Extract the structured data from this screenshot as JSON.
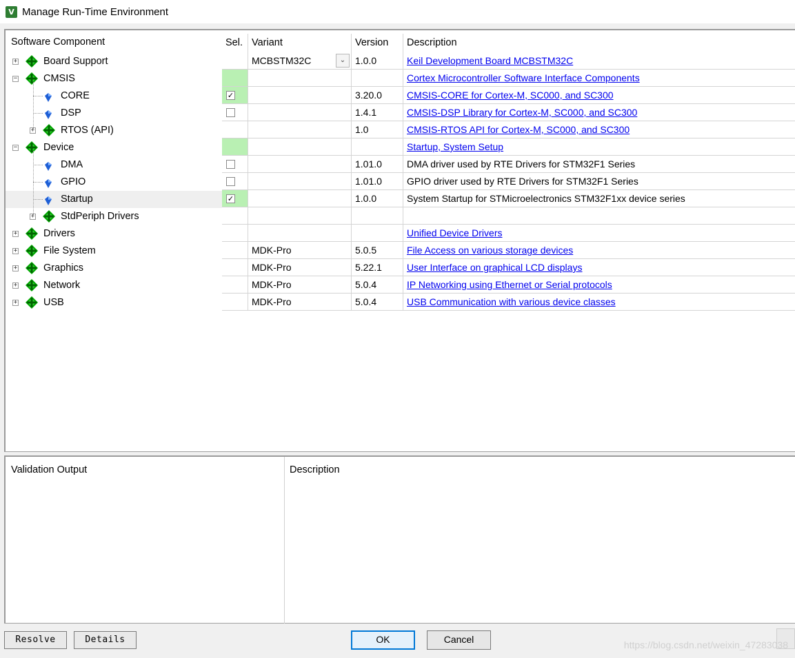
{
  "window": {
    "title": "Manage Run-Time Environment",
    "icon": "keil-app-icon"
  },
  "columns": {
    "component": "Software Component",
    "sel": "Sel.",
    "variant": "Variant",
    "version": "Version",
    "description": "Description"
  },
  "rows": [
    {
      "label": "Board Support",
      "level": 0,
      "expander": "+",
      "icon": "green-diamond-icon",
      "sel": "",
      "sel_green": false,
      "variant": "MCBSTM32C",
      "dropdown": true,
      "version": "1.0.0",
      "desc": "Keil Development Board MCBSTM32C",
      "link": true
    },
    {
      "label": "CMSIS",
      "level": 0,
      "expander": "−",
      "icon": "green-diamond-icon",
      "sel": "",
      "sel_green": true,
      "variant": "",
      "version": "",
      "desc": "Cortex Microcontroller Software Interface Components",
      "link": true
    },
    {
      "label": "CORE",
      "level": 1,
      "expander": "",
      "icon": "blue-gem-icon",
      "sel": "checked",
      "sel_green": true,
      "variant": "",
      "version": "3.20.0",
      "desc": "CMSIS-CORE for Cortex-M, SC000, and SC300",
      "link": true
    },
    {
      "label": "DSP",
      "level": 1,
      "expander": "",
      "icon": "blue-gem-icon",
      "sel": "unchecked",
      "sel_green": false,
      "variant": "",
      "version": "1.4.1",
      "desc": "CMSIS-DSP Library for Cortex-M, SC000, and SC300",
      "link": true
    },
    {
      "label": "RTOS (API)",
      "level": 1,
      "expander": "+",
      "icon": "green-diamond-icon",
      "sel": "",
      "sel_green": false,
      "variant": "",
      "version": "1.0",
      "desc": "CMSIS-RTOS API for Cortex-M, SC000, and SC300",
      "link": true
    },
    {
      "label": "Device",
      "level": 0,
      "expander": "−",
      "icon": "green-diamond-icon",
      "sel": "",
      "sel_green": true,
      "variant": "",
      "version": "",
      "desc": "Startup, System Setup",
      "link": true
    },
    {
      "label": "DMA",
      "level": 1,
      "expander": "",
      "icon": "blue-gem-icon",
      "sel": "unchecked",
      "sel_green": false,
      "variant": "",
      "version": "1.01.0",
      "desc": "DMA driver used by RTE Drivers for STM32F1 Series",
      "link": false
    },
    {
      "label": "GPIO",
      "level": 1,
      "expander": "",
      "icon": "blue-gem-icon",
      "sel": "unchecked",
      "sel_green": false,
      "variant": "",
      "version": "1.01.0",
      "desc": "GPIO driver used by RTE Drivers for STM32F1 Series",
      "link": false
    },
    {
      "label": "Startup",
      "level": 1,
      "expander": "",
      "icon": "blue-gem-icon",
      "sel": "checked",
      "sel_green": true,
      "variant": "",
      "version": "1.0.0",
      "desc": "System Startup for STMicroelectronics STM32F1xx device series",
      "link": false,
      "selected": true
    },
    {
      "label": "StdPeriph Drivers",
      "level": 1,
      "expander": "+",
      "icon": "green-diamond-icon",
      "sel": "",
      "sel_green": false,
      "variant": "",
      "version": "",
      "desc": "",
      "link": false
    },
    {
      "label": "Drivers",
      "level": 0,
      "expander": "+",
      "icon": "green-diamond-icon",
      "sel": "",
      "sel_green": false,
      "variant": "",
      "version": "",
      "desc": "Unified Device Drivers",
      "link": true
    },
    {
      "label": "File System",
      "level": 0,
      "expander": "+",
      "icon": "green-diamond-icon",
      "sel": "",
      "sel_green": false,
      "variant": "MDK-Pro",
      "version": "5.0.5",
      "desc": "File Access on various storage devices",
      "link": true
    },
    {
      "label": "Graphics",
      "level": 0,
      "expander": "+",
      "icon": "green-diamond-icon",
      "sel": "",
      "sel_green": false,
      "variant": "MDK-Pro",
      "version": "5.22.1",
      "desc": "User Interface on graphical LCD displays",
      "link": true
    },
    {
      "label": "Network",
      "level": 0,
      "expander": "+",
      "icon": "green-diamond-icon",
      "sel": "",
      "sel_green": false,
      "variant": "MDK-Pro",
      "version": "5.0.4",
      "desc": "IP Networking using Ethernet or Serial protocols",
      "link": true
    },
    {
      "label": "USB",
      "level": 0,
      "expander": "+",
      "icon": "green-diamond-icon",
      "sel": "",
      "sel_green": false,
      "variant": "MDK-Pro",
      "version": "5.0.4",
      "desc": "USB Communication with various device classes",
      "link": true
    }
  ],
  "lower": {
    "validation_output": "Validation Output",
    "description": "Description"
  },
  "buttons": {
    "resolve": "Resolve",
    "details": "Details",
    "ok": "OK",
    "cancel": "Cancel"
  },
  "watermark": "https://blog.csdn.net/weixin_47283038",
  "colors": {
    "green_cell": "#b9f0b3",
    "link": "#0000ee",
    "diamond": "#00b000",
    "gem": "#1e5fd6"
  }
}
